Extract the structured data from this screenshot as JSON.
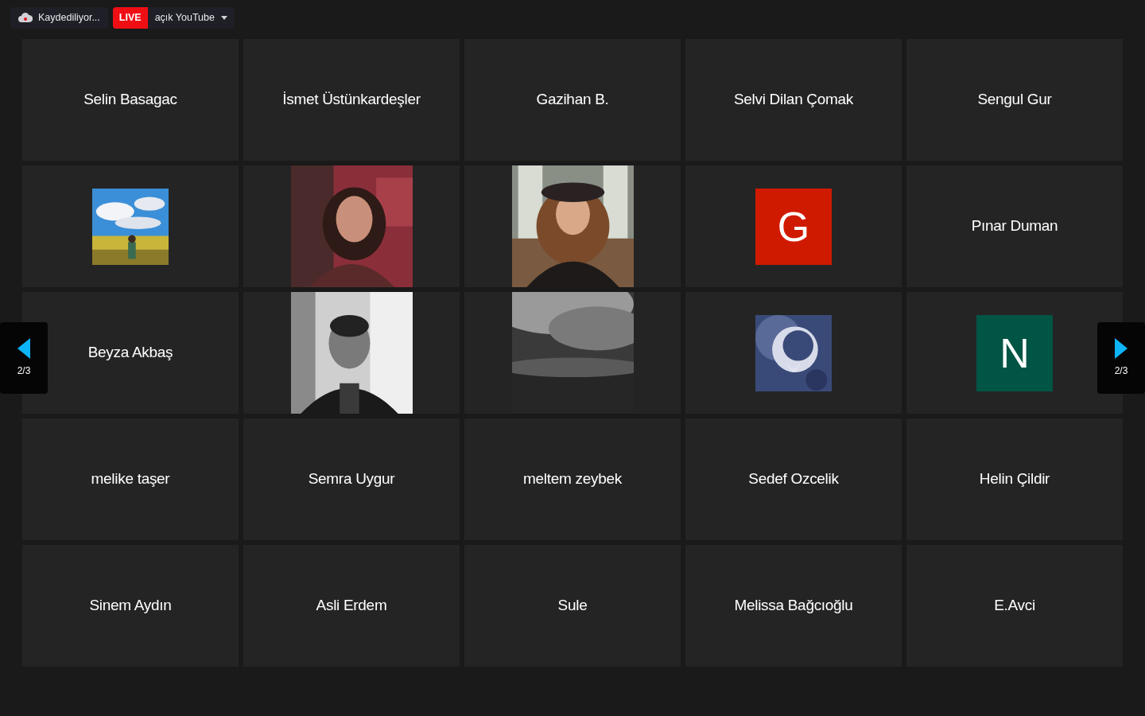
{
  "toolbar": {
    "recording": {
      "label": "Kaydediliyor..."
    },
    "live": {
      "badge": "LIVE",
      "label": "açık YouTube"
    }
  },
  "pager": {
    "previous": {
      "label": "2/3"
    },
    "next": {
      "label": "2/3"
    }
  },
  "tiles": [
    {
      "kind": "name",
      "name": "Selin Basagac"
    },
    {
      "kind": "name",
      "name": "İsmet Üstünkardeşler"
    },
    {
      "kind": "name",
      "name": "Gazihan B."
    },
    {
      "kind": "name",
      "name": "Selvi Dilan Çomak"
    },
    {
      "kind": "name",
      "name": "Sengul Gur"
    },
    {
      "kind": "thumbnail"
    },
    {
      "kind": "picture"
    },
    {
      "kind": "picture"
    },
    {
      "kind": "letter",
      "letter": "G",
      "color": "#d01a00"
    },
    {
      "kind": "name",
      "name": "Pınar Duman"
    },
    {
      "kind": "name",
      "name": "Beyza Akbaş"
    },
    {
      "kind": "picture"
    },
    {
      "kind": "picture"
    },
    {
      "kind": "thumbnail"
    },
    {
      "kind": "letter",
      "letter": "N",
      "color": "#015544"
    },
    {
      "kind": "name",
      "name": "melike taşer"
    },
    {
      "kind": "name",
      "name": "Semra Uygur"
    },
    {
      "kind": "name",
      "name": "meltem zeybek"
    },
    {
      "kind": "name",
      "name": "Sedef Ozcelik"
    },
    {
      "kind": "name",
      "name": "Helin Çildir"
    },
    {
      "kind": "name",
      "name": "Sinem Aydın"
    },
    {
      "kind": "name",
      "name": "Asli Erdem"
    },
    {
      "kind": "name",
      "name": "Sule"
    },
    {
      "kind": "name",
      "name": "Melissa Bağcıoğlu"
    },
    {
      "kind": "name",
      "name": "E.Avci"
    }
  ]
}
